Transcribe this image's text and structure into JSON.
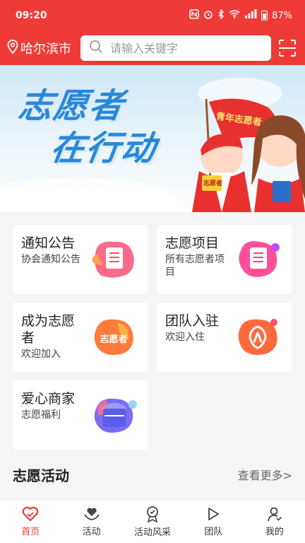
{
  "status_bar": {
    "time": "09:20",
    "battery": "87%"
  },
  "header": {
    "city": "哈尔滨市",
    "search_placeholder": "请输入关键字"
  },
  "banner": {
    "line1": "志愿者",
    "line2": "在行动",
    "flag_text": "青年志愿者",
    "book_text": "志愿者"
  },
  "cards": [
    {
      "title": "通知公告",
      "sub": "协会通知公告",
      "icon": "document-icon",
      "colors": [
        "#ff5a78",
        "#ff9a3c"
      ]
    },
    {
      "title": "志愿项目",
      "sub": "所有志愿者项目",
      "icon": "list-icon",
      "colors": [
        "#ff4f8b",
        "#c04cf0"
      ]
    },
    {
      "title": "成为志愿者",
      "sub": "欢迎加入",
      "icon": "volunteer-logo-icon",
      "icon_text": "志愿者",
      "colors": [
        "#ff7a3c",
        "#ffb23c"
      ]
    },
    {
      "title": "团队入驻",
      "sub": "欢迎入住",
      "icon": "team-logo-icon",
      "colors": [
        "#ff6a3c",
        "#ff4f6a"
      ]
    },
    {
      "title": "爱心商家",
      "sub": "志愿福利",
      "icon": "shop-icon",
      "colors": [
        "#6a6cf5",
        "#9b5cf5"
      ]
    }
  ],
  "section": {
    "title": "志愿活动",
    "more": "查看更多>"
  },
  "tabs": [
    {
      "label": "首页",
      "icon": "heart-icon",
      "active": true
    },
    {
      "label": "活动",
      "icon": "hands-heart-icon",
      "active": false
    },
    {
      "label": "活动风采",
      "icon": "medal-icon",
      "active": false
    },
    {
      "label": "团队",
      "icon": "play-icon",
      "active": false
    },
    {
      "label": "我的",
      "icon": "user-icon",
      "active": false
    }
  ],
  "colors": {
    "brand": "#ee3b37"
  }
}
